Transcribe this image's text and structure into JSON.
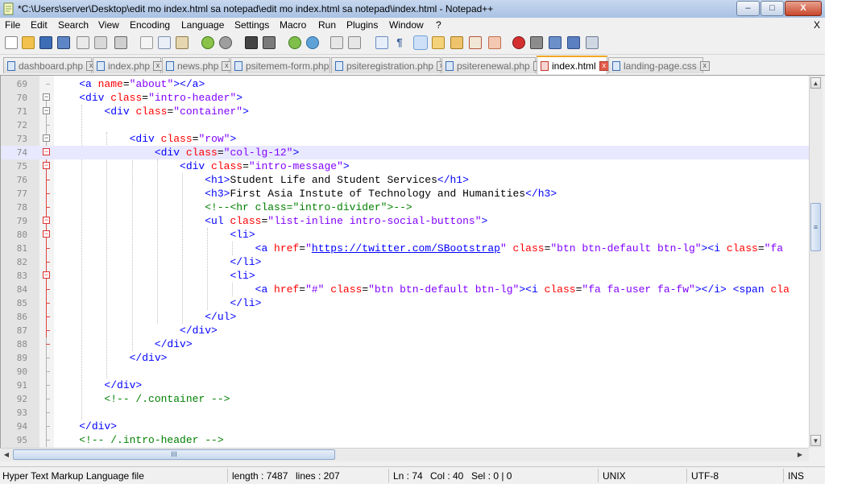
{
  "window": {
    "title": "*C:\\Users\\server\\Desktop\\edit mo index.html sa notepad\\edit mo index.html sa notepad\\index.html - Notepad++",
    "minimize": "‒",
    "maximize": "□",
    "close": "X"
  },
  "menu": {
    "items": [
      "File",
      "Edit",
      "Search",
      "View",
      "Encoding",
      "Language",
      "Settings",
      "Macro",
      "Run",
      "Plugins",
      "Window",
      "?"
    ],
    "close": "X"
  },
  "tabs": [
    {
      "label": "dashboard.php",
      "active": false
    },
    {
      "label": "index.php",
      "active": false
    },
    {
      "label": "news.php",
      "active": false
    },
    {
      "label": "psitemem-form.php",
      "active": false
    },
    {
      "label": "psiteregistration.php",
      "active": false
    },
    {
      "label": "psiterenewal.php",
      "active": false
    },
    {
      "label": "index.html",
      "active": true
    },
    {
      "label": "landing-page.css",
      "active": false
    }
  ],
  "editor": {
    "current_line": 74,
    "lines": [
      {
        "num": "69",
        "fold": "",
        "segs": [
          [
            "    ",
            "tx"
          ],
          [
            "<a ",
            "tg"
          ],
          [
            "name",
            "at"
          ],
          [
            "=",
            "tx"
          ],
          [
            "\"about\"",
            "av"
          ],
          [
            "></a>",
            "tg"
          ]
        ]
      },
      {
        "num": "70",
        "fold": "minus",
        "segs": [
          [
            "    ",
            "tx"
          ],
          [
            "<div ",
            "tg"
          ],
          [
            "class",
            "at"
          ],
          [
            "=",
            "tx"
          ],
          [
            "\"intro-header\"",
            "av"
          ],
          [
            ">",
            "tg"
          ]
        ]
      },
      {
        "num": "71",
        "fold": "minus",
        "segs": [
          [
            "        ",
            "tx"
          ],
          [
            "<div ",
            "tg"
          ],
          [
            "class",
            "at"
          ],
          [
            "=",
            "tx"
          ],
          [
            "\"container\"",
            "av"
          ],
          [
            ">",
            "tg"
          ]
        ]
      },
      {
        "num": "72",
        "fold": "",
        "segs": []
      },
      {
        "num": "73",
        "fold": "minus",
        "segs": [
          [
            "            ",
            "tx"
          ],
          [
            "<div ",
            "tg"
          ],
          [
            "class",
            "at"
          ],
          [
            "=",
            "tx"
          ],
          [
            "\"row\"",
            "av"
          ],
          [
            ">",
            "tg"
          ]
        ]
      },
      {
        "num": "74",
        "fold": "minus-red",
        "segs": [
          [
            "                ",
            "tx"
          ],
          [
            "<div ",
            "tg"
          ],
          [
            "class",
            "at"
          ],
          [
            "=",
            "tx"
          ],
          [
            "\"col-lg-12\"",
            "av"
          ],
          [
            ">",
            "tg"
          ]
        ]
      },
      {
        "num": "75",
        "fold": "minus-red",
        "segs": [
          [
            "                    ",
            "tx"
          ],
          [
            "<div ",
            "tg"
          ],
          [
            "class",
            "at"
          ],
          [
            "=",
            "tx"
          ],
          [
            "\"intro-message\"",
            "av"
          ],
          [
            ">",
            "tg"
          ]
        ]
      },
      {
        "num": "76",
        "fold": "",
        "segs": [
          [
            "                        ",
            "tx"
          ],
          [
            "<h1>",
            "tg"
          ],
          [
            "Student Life and Student Services",
            "tx"
          ],
          [
            "</h1>",
            "tg"
          ]
        ]
      },
      {
        "num": "77",
        "fold": "",
        "segs": [
          [
            "                        ",
            "tx"
          ],
          [
            "<h3>",
            "tg"
          ],
          [
            "First Asia Instute of Technology and Humanities",
            "tx"
          ],
          [
            "</h3>",
            "tg"
          ]
        ]
      },
      {
        "num": "78",
        "fold": "",
        "segs": [
          [
            "                        ",
            "tx"
          ],
          [
            "<!--<hr class=\"intro-divider\">-->",
            "cm"
          ]
        ]
      },
      {
        "num": "79",
        "fold": "minus-red",
        "segs": [
          [
            "                        ",
            "tx"
          ],
          [
            "<ul ",
            "tg"
          ],
          [
            "class",
            "at"
          ],
          [
            "=",
            "tx"
          ],
          [
            "\"list-inline intro-social-buttons\"",
            "av"
          ],
          [
            ">",
            "tg"
          ]
        ]
      },
      {
        "num": "80",
        "fold": "minus-red",
        "segs": [
          [
            "                            ",
            "tx"
          ],
          [
            "<li>",
            "tg"
          ]
        ]
      },
      {
        "num": "81",
        "fold": "",
        "segs": [
          [
            "                                ",
            "tx"
          ],
          [
            "<a ",
            "tg"
          ],
          [
            "href",
            "at"
          ],
          [
            "=",
            "tx"
          ],
          [
            "\"",
            "av"
          ],
          [
            "https://twitter.com/SBootstrap",
            "ln"
          ],
          [
            "\" ",
            "av"
          ],
          [
            "class",
            "at"
          ],
          [
            "=",
            "tx"
          ],
          [
            "\"btn btn-default btn-lg\"",
            "av"
          ],
          [
            "><i ",
            "tg"
          ],
          [
            "class",
            "at"
          ],
          [
            "=",
            "tx"
          ],
          [
            "\"fa",
            "av"
          ]
        ]
      },
      {
        "num": "82",
        "fold": "",
        "segs": [
          [
            "                            ",
            "tx"
          ],
          [
            "</li>",
            "tg"
          ]
        ]
      },
      {
        "num": "83",
        "fold": "minus-red",
        "segs": [
          [
            "                            ",
            "tx"
          ],
          [
            "<li>",
            "tg"
          ]
        ]
      },
      {
        "num": "84",
        "fold": "",
        "segs": [
          [
            "                                ",
            "tx"
          ],
          [
            "<a ",
            "tg"
          ],
          [
            "href",
            "at"
          ],
          [
            "=",
            "tx"
          ],
          [
            "\"#\" ",
            "av"
          ],
          [
            "class",
            "at"
          ],
          [
            "=",
            "tx"
          ],
          [
            "\"btn btn-default btn-lg\"",
            "av"
          ],
          [
            "><i ",
            "tg"
          ],
          [
            "class",
            "at"
          ],
          [
            "=",
            "tx"
          ],
          [
            "\"fa fa-user fa-fw\"",
            "av"
          ],
          [
            "></i> <span ",
            "tg"
          ],
          [
            "cla",
            "at"
          ]
        ]
      },
      {
        "num": "85",
        "fold": "",
        "segs": [
          [
            "                            ",
            "tx"
          ],
          [
            "</li>",
            "tg"
          ]
        ]
      },
      {
        "num": "86",
        "fold": "",
        "segs": [
          [
            "                        ",
            "tx"
          ],
          [
            "</ul>",
            "tg"
          ]
        ]
      },
      {
        "num": "87",
        "fold": "",
        "segs": [
          [
            "                    ",
            "tx"
          ],
          [
            "</div>",
            "tg"
          ]
        ]
      },
      {
        "num": "88",
        "fold": "",
        "segs": [
          [
            "                ",
            "tx"
          ],
          [
            "</div>",
            "tg"
          ]
        ]
      },
      {
        "num": "89",
        "fold": "",
        "segs": [
          [
            "            ",
            "tx"
          ],
          [
            "</div>",
            "tg"
          ]
        ]
      },
      {
        "num": "90",
        "fold": "",
        "segs": []
      },
      {
        "num": "91",
        "fold": "",
        "segs": [
          [
            "        ",
            "tx"
          ],
          [
            "</div>",
            "tg"
          ]
        ]
      },
      {
        "num": "92",
        "fold": "",
        "segs": [
          [
            "        ",
            "tx"
          ],
          [
            "<!-- /.container -->",
            "cm"
          ]
        ]
      },
      {
        "num": "93",
        "fold": "",
        "segs": []
      },
      {
        "num": "94",
        "fold": "",
        "segs": [
          [
            "    ",
            "tx"
          ],
          [
            "</div>",
            "tg"
          ]
        ]
      },
      {
        "num": "95",
        "fold": "",
        "segs": [
          [
            "    ",
            "tx"
          ],
          [
            "<!-- /.intro-header -->",
            "cm"
          ]
        ]
      }
    ]
  },
  "scroll": {
    "up": "▲",
    "down": "▼",
    "left": "◀",
    "right": "▶",
    "grip_v": "≡",
    "grip_h": "III"
  },
  "status": {
    "file_type": "Hyper Text Markup Language file",
    "length": "length : 7487",
    "lines": "lines : 207",
    "ln": "Ln : 74",
    "col": "Col : 40",
    "sel": "Sel : 0 | 0",
    "eol": "UNIX",
    "encoding": "UTF-8",
    "mode": "INS"
  },
  "colors": {
    "keyword_tag": "#0000ff",
    "attribute": "#ff0000",
    "attr_value": "#8000ff",
    "comment": "#008000",
    "current_line": "#e8e8ff"
  }
}
